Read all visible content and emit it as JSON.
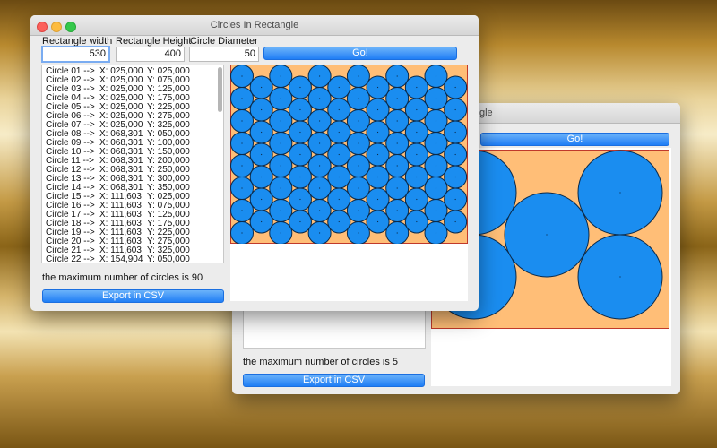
{
  "front": {
    "title": "Circles In Rectangle",
    "width_label": "Rectangle width",
    "height_label": "Rectangle Height",
    "diameter_label": "Circle Diameter",
    "width_value": "530",
    "height_value": "400",
    "diameter_value": "50",
    "go_label": "Go!",
    "status": "the maximum number of circles is 90",
    "export_label": "Export in CSV",
    "circles": [
      {
        "name": "Circle 01 -->",
        "x": "X: 025,000",
        "y": "Y: 025,000"
      },
      {
        "name": "Circle 02 -->",
        "x": "X: 025,000",
        "y": "Y: 075,000"
      },
      {
        "name": "Circle 03 -->",
        "x": "X: 025,000",
        "y": "Y: 125,000"
      },
      {
        "name": "Circle 04 -->",
        "x": "X: 025,000",
        "y": "Y: 175,000"
      },
      {
        "name": "Circle 05 -->",
        "x": "X: 025,000",
        "y": "Y: 225,000"
      },
      {
        "name": "Circle 06 -->",
        "x": "X: 025,000",
        "y": "Y: 275,000"
      },
      {
        "name": "Circle 07 -->",
        "x": "X: 025,000",
        "y": "Y: 325,000"
      },
      {
        "name": "Circle 08 -->",
        "x": "X: 068,301",
        "y": "Y: 050,000"
      },
      {
        "name": "Circle 09 -->",
        "x": "X: 068,301",
        "y": "Y: 100,000"
      },
      {
        "name": "Circle 10 -->",
        "x": "X: 068,301",
        "y": "Y: 150,000"
      },
      {
        "name": "Circle 11 -->",
        "x": "X: 068,301",
        "y": "Y: 200,000"
      },
      {
        "name": "Circle 12 -->",
        "x": "X: 068,301",
        "y": "Y: 250,000"
      },
      {
        "name": "Circle 13 -->",
        "x": "X: 068,301",
        "y": "Y: 300,000"
      },
      {
        "name": "Circle 14 -->",
        "x": "X: 068,301",
        "y": "Y: 350,000"
      },
      {
        "name": "Circle 15 -->",
        "x": "X: 111,603",
        "y": "Y: 025,000"
      },
      {
        "name": "Circle 16 -->",
        "x": "X: 111,603",
        "y": "Y: 075,000"
      },
      {
        "name": "Circle 17 -->",
        "x": "X: 111,603",
        "y": "Y: 125,000"
      },
      {
        "name": "Circle 18 -->",
        "x": "X: 111,603",
        "y": "Y: 175,000"
      },
      {
        "name": "Circle 19 -->",
        "x": "X: 111,603",
        "y": "Y: 225,000"
      },
      {
        "name": "Circle 20 -->",
        "x": "X: 111,603",
        "y": "Y: 275,000"
      },
      {
        "name": "Circle 21 -->",
        "x": "X: 111,603",
        "y": "Y: 325,000"
      },
      {
        "name": "Circle 22 -->",
        "x": "X: 154,904",
        "y": "Y: 050,000"
      }
    ]
  },
  "back": {
    "title_partial": "gle",
    "go_label": "Go!",
    "status": "the maximum number of circles is 5",
    "export_label": "Export in CSV"
  },
  "colors": {
    "circle_fill": "#1a8df0",
    "rect_fill": "#ffbe77",
    "rect_border": "#c0392b",
    "button": "#1f7ef5"
  }
}
